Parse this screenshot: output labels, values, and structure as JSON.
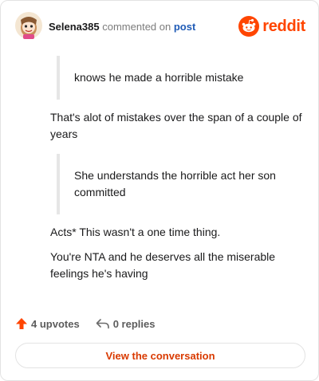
{
  "comment": {
    "username": "Selena385",
    "action_text": "commented on",
    "post_link": "post",
    "avatar_icon": "avatar-snoo-icon"
  },
  "brand": {
    "icon": "reddit-snoo-icon",
    "name": "reddit",
    "color": "#ff4500"
  },
  "body": {
    "quote1": "knows he made a horrible mistake",
    "para1": "That's alot of mistakes over the span of a couple of years",
    "quote2": "She understands the horrible act her son committed",
    "para2": "Acts* This wasn't a one time thing.",
    "para3": "You're NTA and he deserves all the miserable feelings he's having"
  },
  "stats": {
    "upvotes_label": "4 upvotes",
    "upvote_icon": "upvote-arrow-icon",
    "replies_label": "0 replies",
    "reply_icon": "reply-arrow-icon"
  },
  "cta": {
    "label": "View the conversation",
    "color": "#d93a00"
  }
}
